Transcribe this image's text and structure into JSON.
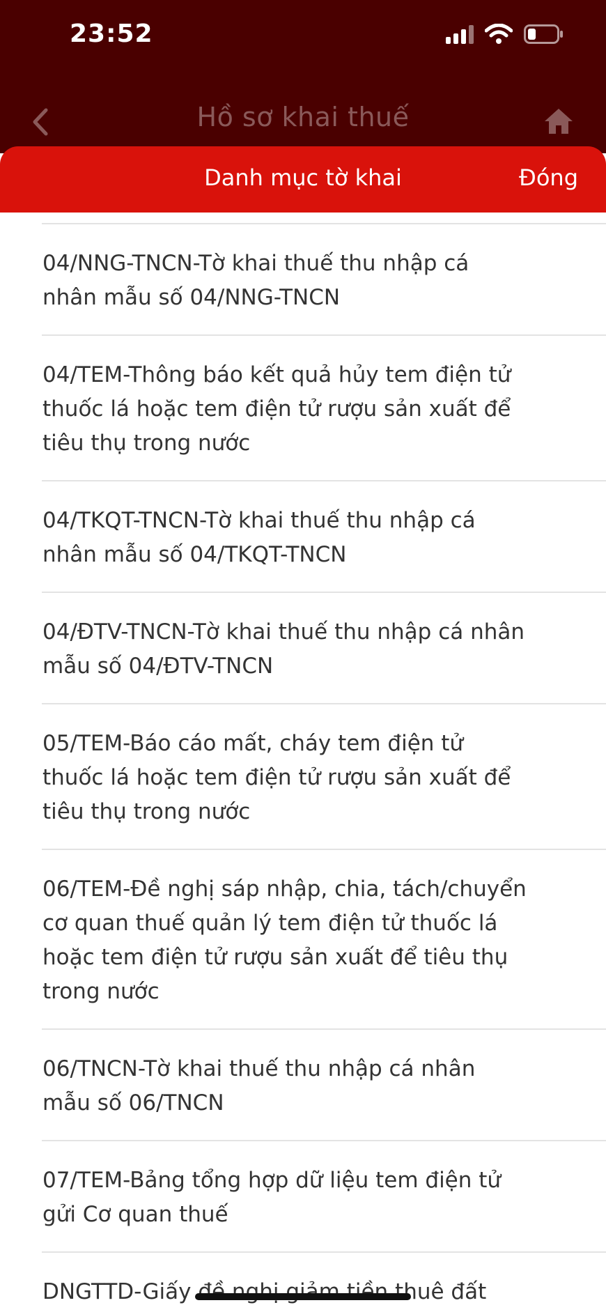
{
  "status_bar": {
    "time": "23:52",
    "icons": [
      "signal-icon",
      "wifi-icon",
      "battery-icon"
    ]
  },
  "nav": {
    "title": "Hồ sơ khai thuế",
    "back_icon": "chevron-left-icon",
    "home_icon": "home-icon"
  },
  "sheet": {
    "title": "Danh mục tờ khai",
    "close_label": "Đóng"
  },
  "list": {
    "items": [
      {
        "label": "04/NNG-TNCN-Tờ khai thuế thu nhập cá nhân mẫu số 04/NNG-TNCN"
      },
      {
        "label": "04/TEM-Thông báo kết quả hủy tem điện tử thuốc lá hoặc tem điện tử rượu sản xuất để tiêu thụ trong nước"
      },
      {
        "label": "04/TKQT-TNCN-Tờ khai thuế thu nhập cá nhân mẫu số 04/TKQT-TNCN"
      },
      {
        "label": "04/ĐTV-TNCN-Tờ khai thuế thu nhập cá nhân mẫu số 04/ĐTV-TNCN"
      },
      {
        "label": "05/TEM-Báo cáo mất, cháy tem điện tử thuốc lá hoặc tem điện tử rượu sản xuất để tiêu thụ trong nước"
      },
      {
        "label": "06/TEM-Đề nghị sáp nhập, chia, tách/chuyển cơ quan thuế quản lý tem điện tử thuốc lá hoặc tem điện tử rượu sản xuất để tiêu thụ trong nước"
      },
      {
        "label": "06/TNCN-Tờ khai thuế thu nhập cá nhân mẫu số 06/TNCN"
      },
      {
        "label": "07/TEM-Bảng tổng hợp dữ liệu tem điện tử gửi Cơ quan thuế"
      },
      {
        "label": "DNGTTD-Giấy đề nghị giảm tiền thuê đất"
      }
    ]
  }
}
